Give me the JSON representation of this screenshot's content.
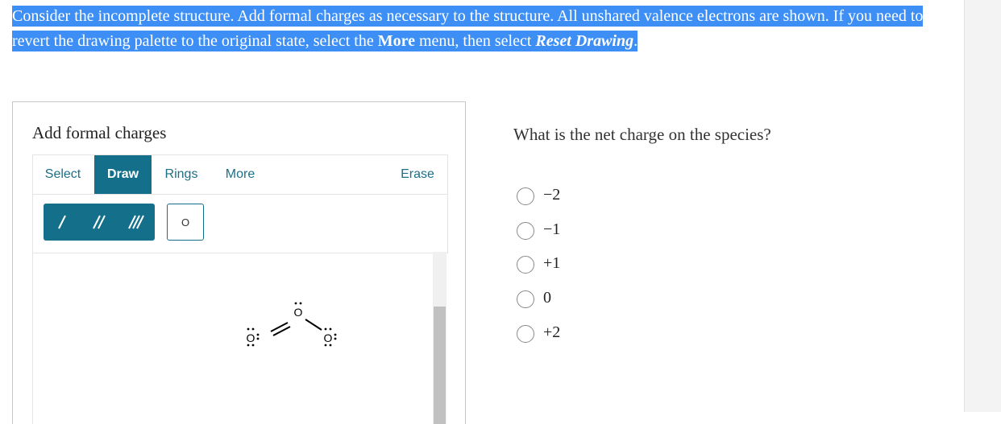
{
  "instructions": {
    "part1": "Consider the incomplete structure. Add formal charges as necessary to the structure. All unshared valence electrons are shown. If you need to revert the drawing palette to the original state, select the ",
    "more": "More",
    "part2": " menu, then select ",
    "reset": "Reset Drawing",
    "part3": "."
  },
  "panel": {
    "title": "Add formal charges",
    "tabs": [
      "Select",
      "Draw",
      "Rings",
      "More",
      "Erase"
    ],
    "active_tab": "Draw",
    "atom_tool": "O"
  },
  "molecule": {
    "atoms": [
      {
        "symbol": "O"
      },
      {
        "symbol": "O"
      },
      {
        "symbol": "O"
      }
    ],
    "bonds": [
      {
        "order": 2
      },
      {
        "order": 1
      }
    ]
  },
  "question": {
    "prompt": "What is the net charge on the species?",
    "choices": [
      "−2",
      "−1",
      "+1",
      "0",
      "+2"
    ]
  },
  "colors": {
    "highlight": "#3d8ff5",
    "teal": "#14708a"
  }
}
